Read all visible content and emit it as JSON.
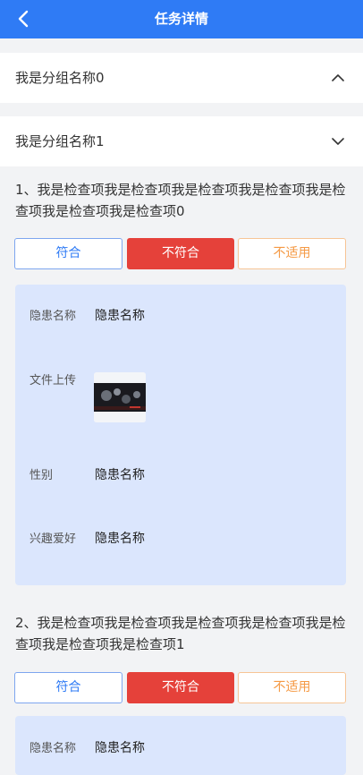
{
  "header": {
    "title": "任务详情"
  },
  "groups": [
    {
      "title": "我是分组名称0",
      "expanded": false
    },
    {
      "title": "我是分组名称1",
      "expanded": true
    }
  ],
  "items": [
    {
      "question": "1、我是检查项我是检查项我是检查项我是检查项我是检查项我是检查项我是检查项0",
      "options": {
        "yes": "符合",
        "no": "不符合",
        "na": "不适用"
      },
      "selected": "不符合",
      "fields": {
        "hazard_name_label": "隐患名称",
        "hazard_name_value": "隐患名称",
        "upload_label": "文件上传",
        "gender_label": "性别",
        "gender_value": "隐患名称",
        "hobby_label": "兴趣爱好",
        "hobby_value": "隐患名称"
      }
    },
    {
      "question": "2、我是检查项我是检查项我是检查项我是检查项我是检查项我是检查项我是检查项1",
      "options": {
        "yes": "符合",
        "no": "不符合",
        "na": "不适用"
      },
      "selected": "不符合",
      "fields": {
        "hazard_name_label": "隐患名称",
        "hazard_name_value": "隐患名称"
      }
    }
  ]
}
